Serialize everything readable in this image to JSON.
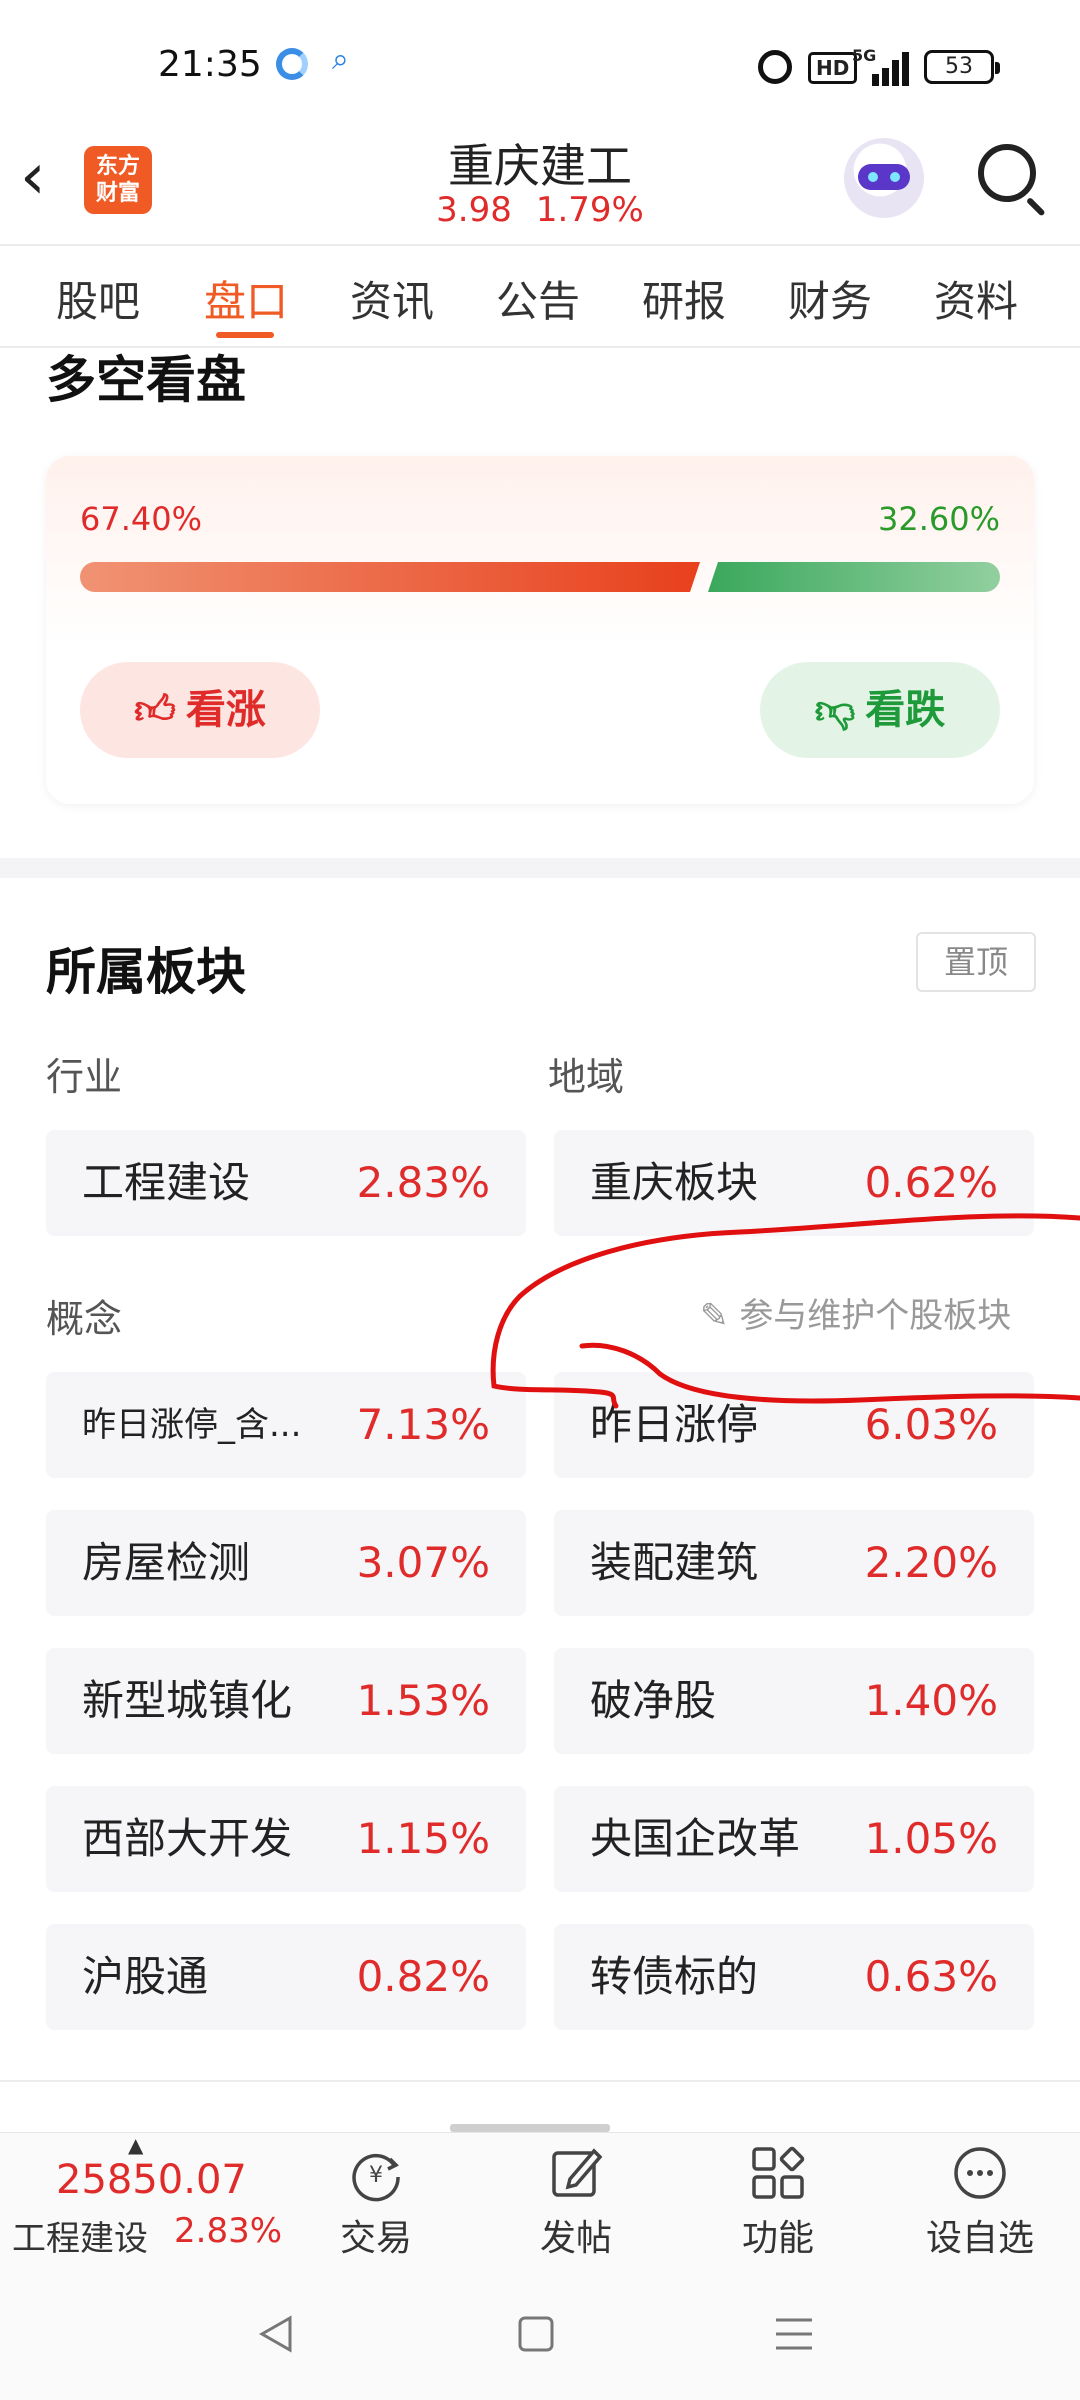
{
  "status_bar": {
    "time": "21:35",
    "hd": "HD",
    "network": "5G",
    "battery": "53"
  },
  "header": {
    "logo_text_line1": "东方",
    "logo_text_line2": "财富",
    "stock_name": "重庆建工",
    "price": "3.98",
    "change_pct": "1.79%"
  },
  "tabs": [
    {
      "label": "股吧"
    },
    {
      "label": "盘口",
      "active": true
    },
    {
      "label": "资讯"
    },
    {
      "label": "公告"
    },
    {
      "label": "研报"
    },
    {
      "label": "财务"
    },
    {
      "label": "资料"
    }
  ],
  "sentiment": {
    "title": "多空看盘",
    "bull_pct": "67.40%",
    "bear_pct": "32.60%",
    "bull_fraction": 0.674,
    "bull_label": "看涨",
    "bear_label": "看跌",
    "bull_color": "#e8401c",
    "bear_color": "#3aa85c"
  },
  "sectors": {
    "title": "所属板块",
    "pin_label": "置顶",
    "industry_label": "行业",
    "region_label": "地域",
    "industry": {
      "name": "工程建设",
      "pct": "2.83%"
    },
    "region": {
      "name": "重庆板块",
      "pct": "0.62%"
    },
    "concept_label": "概念",
    "maintain_label": "参与维护个股板块",
    "concepts": [
      {
        "name": "昨日涨停_含...",
        "pct": "7.13%"
      },
      {
        "name": "昨日涨停",
        "pct": "6.03%"
      },
      {
        "name": "房屋检测",
        "pct": "3.07%"
      },
      {
        "name": "装配建筑",
        "pct": "2.20%"
      },
      {
        "name": "新型城镇化",
        "pct": "1.53%"
      },
      {
        "name": "破净股",
        "pct": "1.40%"
      },
      {
        "name": "西部大开发",
        "pct": "1.15%"
      },
      {
        "name": "央国企改革",
        "pct": "1.05%"
      },
      {
        "name": "沪股通",
        "pct": "0.82%"
      },
      {
        "name": "转债标的",
        "pct": "0.63%"
      }
    ]
  },
  "bottom_bar": {
    "index_value": "25850.07",
    "index_name": "工程建设",
    "index_pct": "2.83%",
    "trade_label": "交易",
    "post_label": "发帖",
    "functions_label": "功能",
    "watchlist_label": "设自选"
  },
  "colors": {
    "accent": "#f05a24",
    "up": "#e02b2b",
    "down": "#2a9a2a",
    "annotation": "#e01010"
  }
}
